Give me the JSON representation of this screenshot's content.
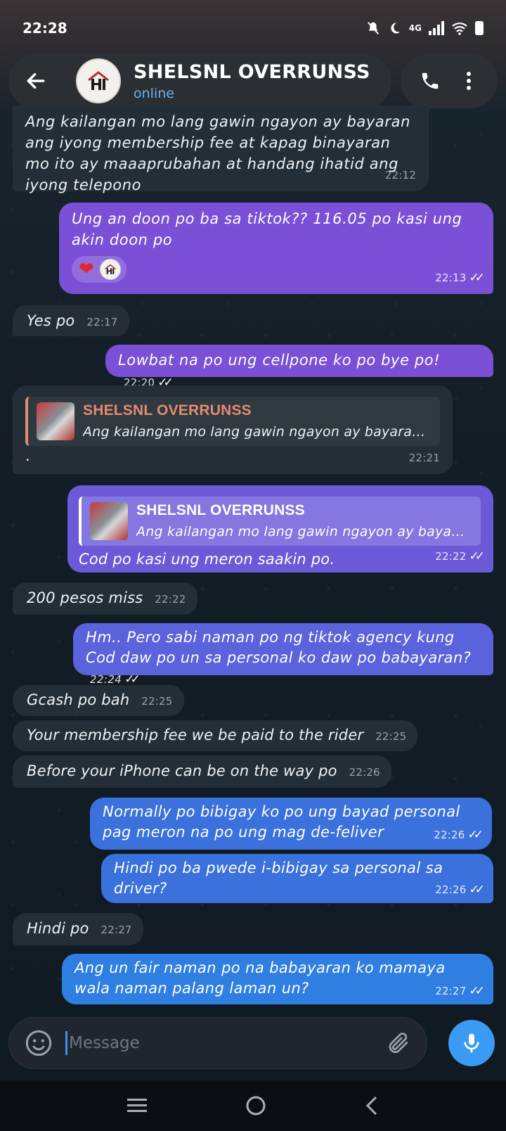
{
  "status_bar": {
    "time": "22:28",
    "network": "4G"
  },
  "header": {
    "contact_name": "SHELSNL OVERRUNSS",
    "contact_status": "online"
  },
  "messages": [
    {
      "dir": "in",
      "text": "Ang kailangan mo lang gawin ngayon ay bayaran ang iyong membership fee at kapag binayaran mo ito ay maaaprubahan at handang ihatid ang iyong telepono",
      "time": "22:12"
    },
    {
      "dir": "out",
      "text": "Ung an doon po ba sa tiktok?? 116.05 po kasi ung akin doon po",
      "time": "22:13",
      "reaction": "❤"
    },
    {
      "dir": "in",
      "text": "Yes po",
      "time": "22:17"
    },
    {
      "dir": "out",
      "text": "Lowbat na po ung cellpone ko po bye po!",
      "time": "22:20"
    },
    {
      "dir": "in",
      "reply_to_name": "SHELSNL OVERRUNSS",
      "reply_to_text": "Ang kailangan mo lang gawin ngayon ay bayaran ang...",
      "text": ".",
      "time": "22:21"
    },
    {
      "dir": "out",
      "reply_to_name": "SHELSNL OVERRUNSS",
      "reply_to_text": "Ang kailangan mo lang gawin ngayon ay bayaran a...",
      "text": "Cod po kasi ung meron saakin po.",
      "time": "22:22"
    },
    {
      "dir": "in",
      "text": "200 pesos miss",
      "time": "22:22"
    },
    {
      "dir": "out",
      "text": "Hm.. Pero sabi naman po ng tiktok agency kung Cod daw po un sa personal ko daw po babayaran?",
      "time": "22:24"
    },
    {
      "dir": "in",
      "text": "Gcash po bah",
      "time": "22:25"
    },
    {
      "dir": "in",
      "text": "Your membership fee we be paid to the rider",
      "time": "22:25"
    },
    {
      "dir": "in",
      "text": "Before your iPhone can be on the way po",
      "time": "22:26"
    },
    {
      "dir": "out",
      "text": "Normally po bibigay ko po ung bayad personal pag meron na po ung mag de-feliver",
      "time": "22:26"
    },
    {
      "dir": "out",
      "text": "Hindi po ba pwede i-bibigay sa personal sa driver?",
      "time": "22:26"
    },
    {
      "dir": "in",
      "text": "Hindi po",
      "time": "22:27"
    },
    {
      "dir": "out",
      "text": "Ang un fair naman po na babayaran ko mamaya wala naman palang laman un?",
      "time": "22:27"
    }
  ],
  "composer": {
    "placeholder": "Message"
  },
  "colors": {
    "accent": "#3b9af3",
    "incoming": "#232e36",
    "outgoing_purple": "#7b4fd6",
    "outgoing_blue": "#3b71dc"
  }
}
